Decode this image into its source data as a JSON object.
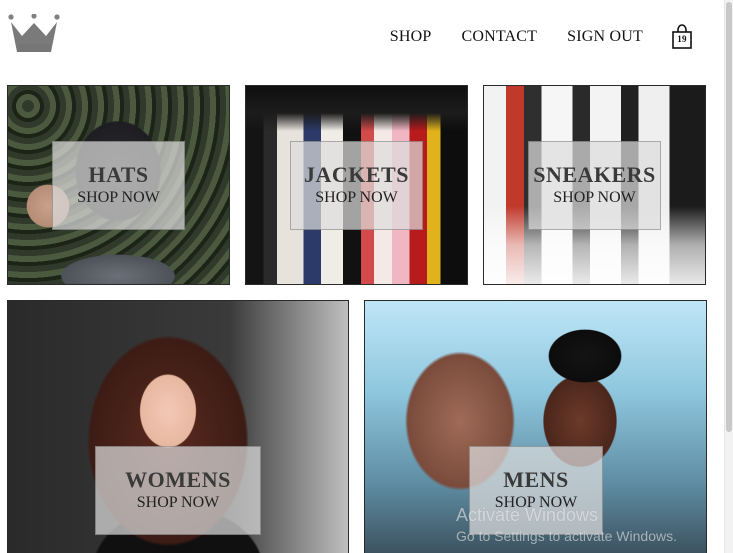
{
  "header": {
    "nav": [
      {
        "label": "SHOP"
      },
      {
        "label": "CONTACT"
      },
      {
        "label": "SIGN OUT"
      }
    ],
    "cart": {
      "count": "19"
    }
  },
  "categories": [
    {
      "title": "HATS",
      "cta": "SHOP NOW"
    },
    {
      "title": "JACKETS",
      "cta": "SHOP NOW"
    },
    {
      "title": "SNEAKERS",
      "cta": "SHOP NOW"
    },
    {
      "title": "WOMENS",
      "cta": "SHOP NOW"
    },
    {
      "title": "MENS",
      "cta": "SHOP NOW"
    }
  ],
  "overlay": {
    "title": "Activate Windows",
    "subtitle": "Go to Settings to activate Windows."
  }
}
